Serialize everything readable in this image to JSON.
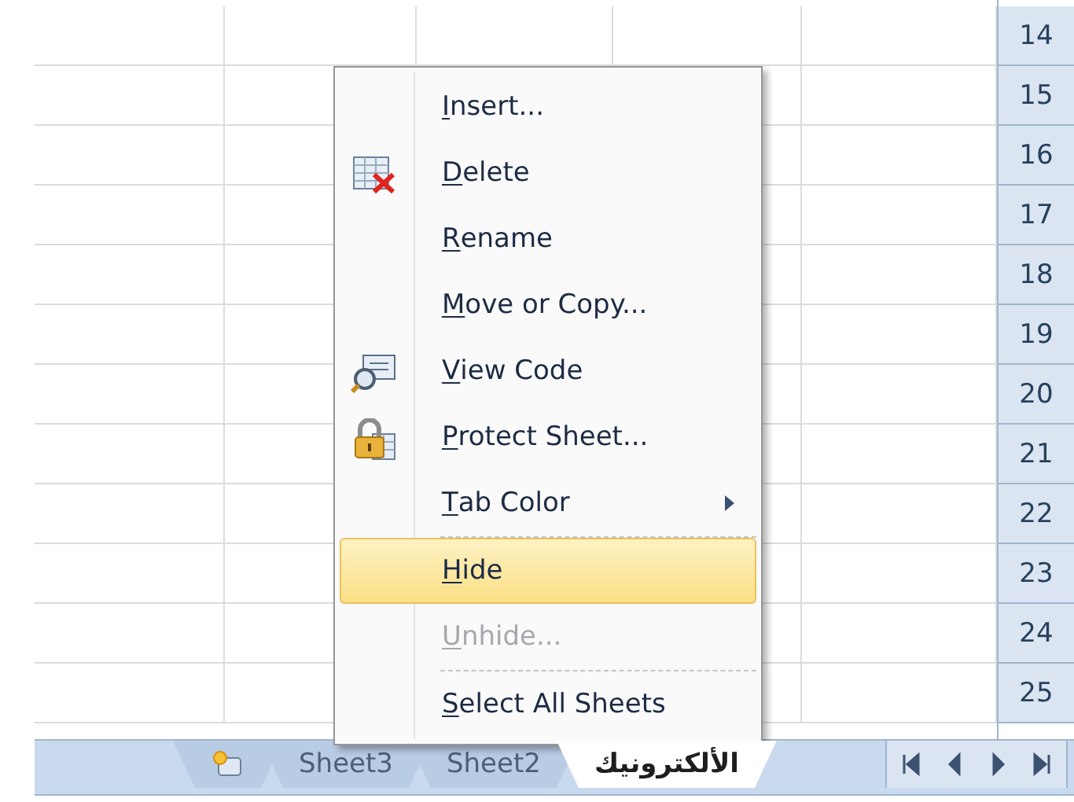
{
  "sheet": {
    "row_headers": [
      "14",
      "15",
      "16",
      "17",
      "18",
      "19",
      "20",
      "21",
      "22",
      "23",
      "24",
      "25"
    ]
  },
  "context_menu": {
    "items": [
      {
        "kind": "item",
        "label": "Insert...",
        "selected": false,
        "disabled": false
      },
      {
        "kind": "item",
        "label": "Delete",
        "selected": false,
        "disabled": false
      },
      {
        "kind": "item",
        "label": "Rename",
        "selected": false,
        "disabled": false
      },
      {
        "kind": "item",
        "label": "Move or Copy...",
        "selected": false,
        "disabled": false
      },
      {
        "kind": "item",
        "label": "View Code",
        "selected": false,
        "disabled": false
      },
      {
        "kind": "item",
        "label": "Protect Sheet...",
        "selected": false,
        "disabled": false
      },
      {
        "kind": "submenu",
        "label": "Tab Color",
        "selected": false,
        "disabled": false
      },
      {
        "kind": "separator"
      },
      {
        "kind": "item",
        "label": "Hide",
        "selected": true,
        "disabled": false
      },
      {
        "kind": "item",
        "label": "Unhide...",
        "selected": false,
        "disabled": true
      },
      {
        "kind": "separator"
      },
      {
        "kind": "item",
        "label": "Select All Sheets",
        "selected": false,
        "disabled": false
      }
    ]
  },
  "sheet_tabs": [
    {
      "kind": "new_sheet"
    },
    {
      "kind": "sheet",
      "label": "Sheet3",
      "selected": false
    },
    {
      "kind": "sheet",
      "label": "Sheet2",
      "selected": false
    },
    {
      "kind": "sheet",
      "label": "الألكترونيك",
      "selected": true
    }
  ]
}
